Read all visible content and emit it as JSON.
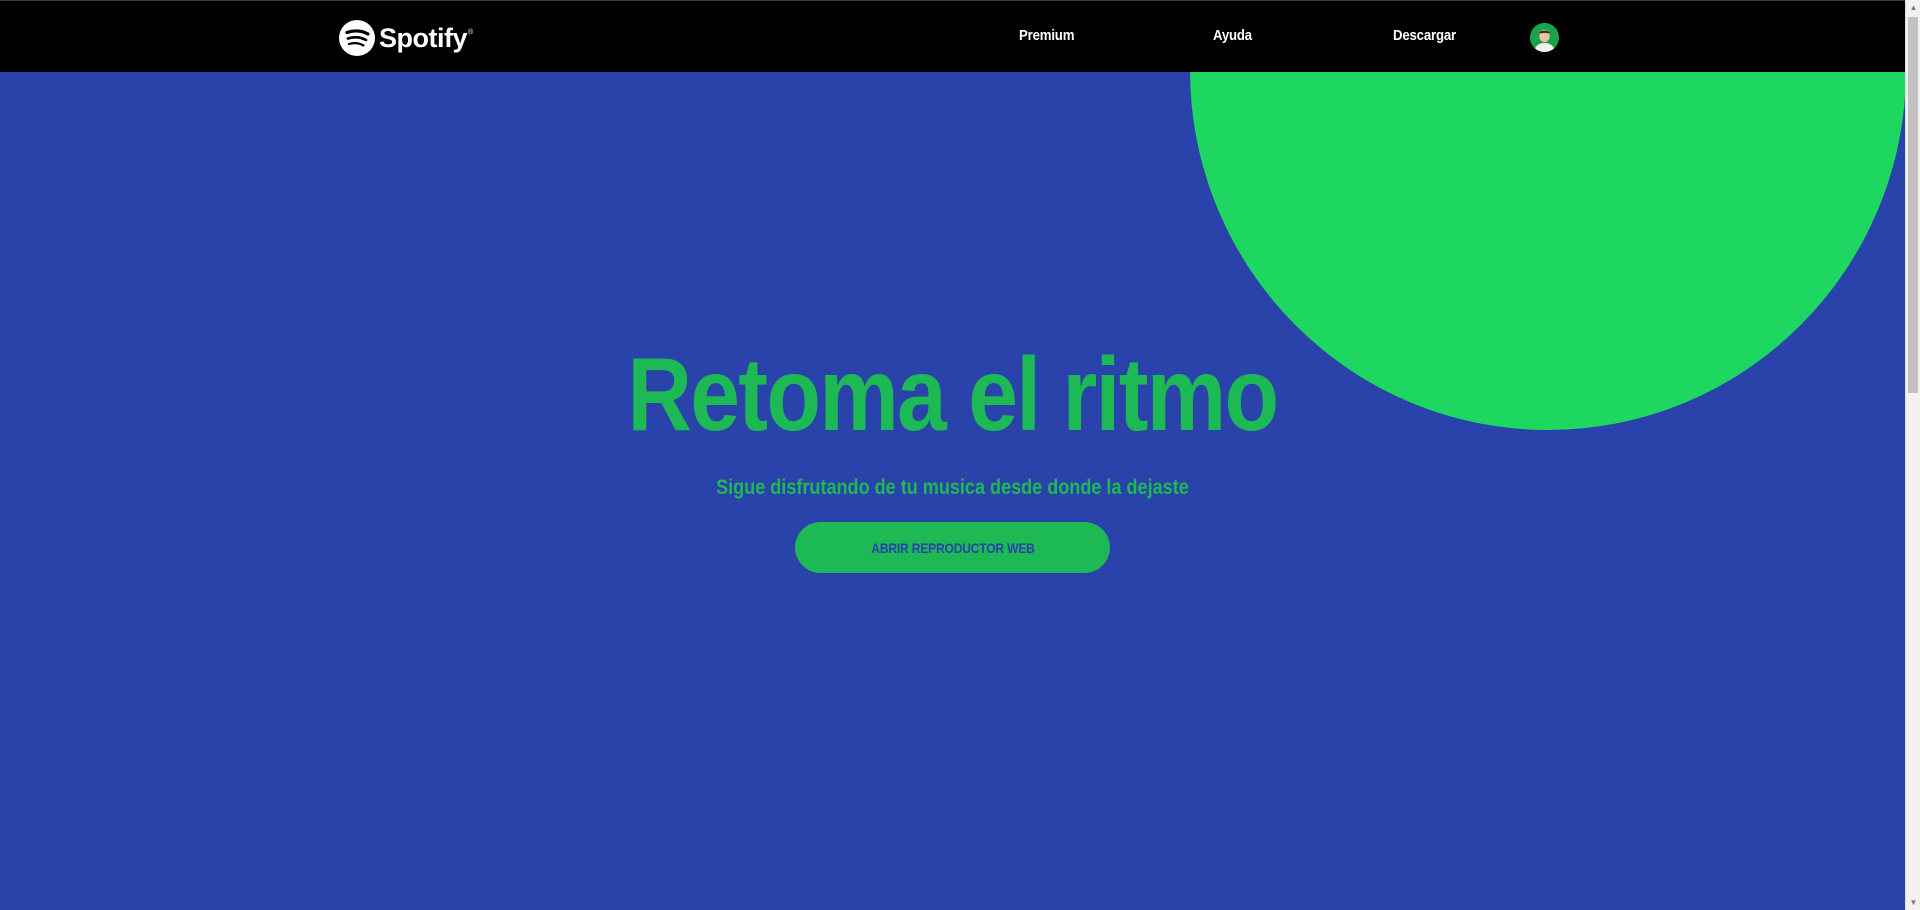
{
  "nav": {
    "brand": "Spotify",
    "brand_mark": "®",
    "links": [
      {
        "label": "Premium"
      },
      {
        "label": "Ayuda"
      },
      {
        "label": "Descargar"
      }
    ],
    "avatar_icon": "user-avatar"
  },
  "hero": {
    "title": "Retoma el ritmo",
    "subtitle": "Sigue disfrutando de tu musica desde donde la dejaste",
    "cta_label": "ABRIR REPRODUCTOR WEB"
  },
  "colors": {
    "background": "#2a43aa",
    "navbar": "#000000",
    "accent_green": "#1db954",
    "circle_green": "#1ed760",
    "text_white": "#ffffff"
  },
  "icons": {
    "logo": "spotify-logo-icon",
    "scroll_up": "scroll-up-arrow-icon",
    "scroll_down": "scroll-down-arrow-icon"
  }
}
